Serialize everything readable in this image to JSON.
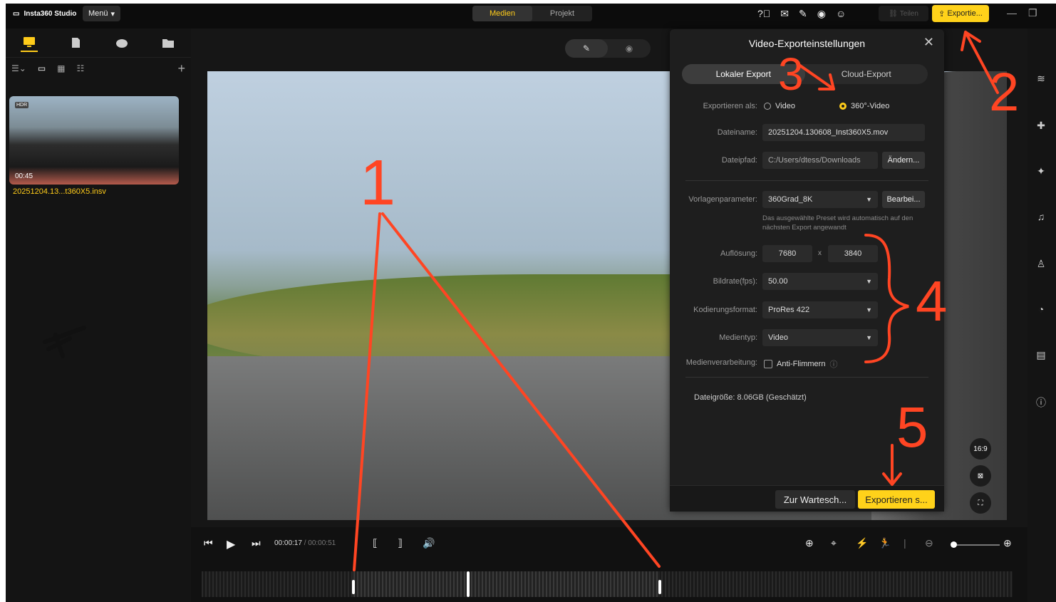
{
  "topbar": {
    "app_title": "Insta360 Studio",
    "menu_label": "Menü",
    "tabs": [
      {
        "label": "Medien"
      },
      {
        "label": "Projekt"
      }
    ],
    "share_label": "Teilen",
    "export_label": "Exportie..."
  },
  "library": {
    "clip": {
      "duration": "00:45",
      "name": "20251204.13...t360X5.insv",
      "badge": "HDR"
    }
  },
  "dialog": {
    "title": "Video-Exporteinstellungen",
    "tabs": [
      {
        "label": "Lokaler Export"
      },
      {
        "label": "Cloud-Export"
      }
    ],
    "export_as_label": "Exportieren als:",
    "export_as_options": [
      {
        "label": "Video"
      },
      {
        "label": "360°-Video"
      }
    ],
    "filename_label": "Dateiname:",
    "filename_value": "20251204.130608_Inst360X5.mov",
    "filepath_label": "Dateipfad:",
    "filepath_value": "C:/Users/dtess/Downloads",
    "change_label": "Ändern...",
    "preset_label": "Vorlagenparameter:",
    "preset_value": "360Grad_8K",
    "edit_label": "Bearbei...",
    "preset_note": "Das ausgewählte Preset wird automatisch auf den nächsten Export angewandt",
    "resolution_label": "Auflösung:",
    "resolution_w": "7680",
    "resolution_x": "x",
    "resolution_h": "3840",
    "framerate_label": "Bildrate(fps):",
    "framerate_value": "50.00",
    "codec_label": "Kodierungsformat:",
    "codec_value": "ProRes 422",
    "mediatype_label": "Medientyp:",
    "mediatype_value": "Video",
    "processing_label": "Medienverarbeitung:",
    "antiflicker_label": "Anti-Flimmern",
    "filesize_text": "Dateigröße: 8.06GB (Geschätzt)",
    "queue_label": "Zur Wartesch...",
    "export_go_label": "Exportieren s..."
  },
  "preview": {
    "aspect_label": "16:9"
  },
  "playback": {
    "current_time": "00:00:17",
    "total_time": "/ 00:00:51"
  },
  "annotations": {
    "n1": "1",
    "n2": "2",
    "n3": "3",
    "n4": "4",
    "n5": "5",
    "color": "#ff4523"
  }
}
